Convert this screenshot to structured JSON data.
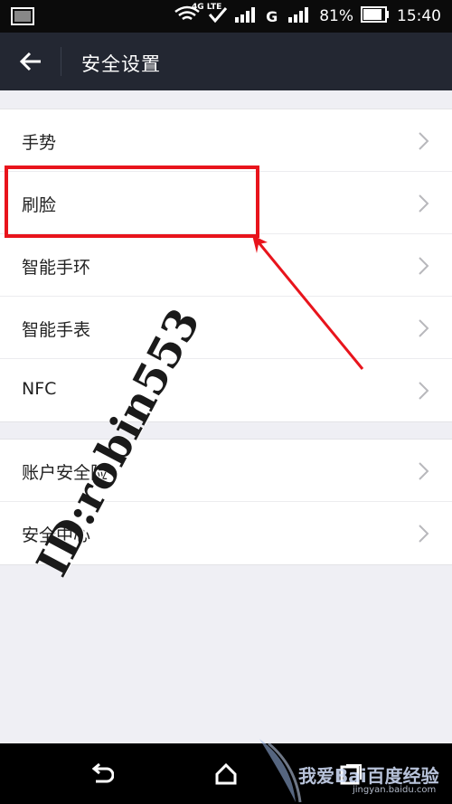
{
  "status_bar": {
    "network_type": "4G LTE",
    "network_letter": "G",
    "battery": "81%",
    "time": "15:40"
  },
  "header": {
    "title": "安全设置"
  },
  "group1": [
    {
      "label": "手势"
    },
    {
      "label": "刷脸"
    },
    {
      "label": "智能手环"
    },
    {
      "label": "智能手表"
    },
    {
      "label": "NFC"
    }
  ],
  "group2": [
    {
      "label": "账户安全险"
    },
    {
      "label": "安全中心"
    }
  ],
  "watermark": {
    "text": "ID:robin553",
    "site": "我爱Bai百度经验",
    "site_url": "jingyan.baidu.com"
  },
  "colors": {
    "header_bg": "#232732",
    "highlight": "#e8141c",
    "page_bg": "#efeff4"
  }
}
